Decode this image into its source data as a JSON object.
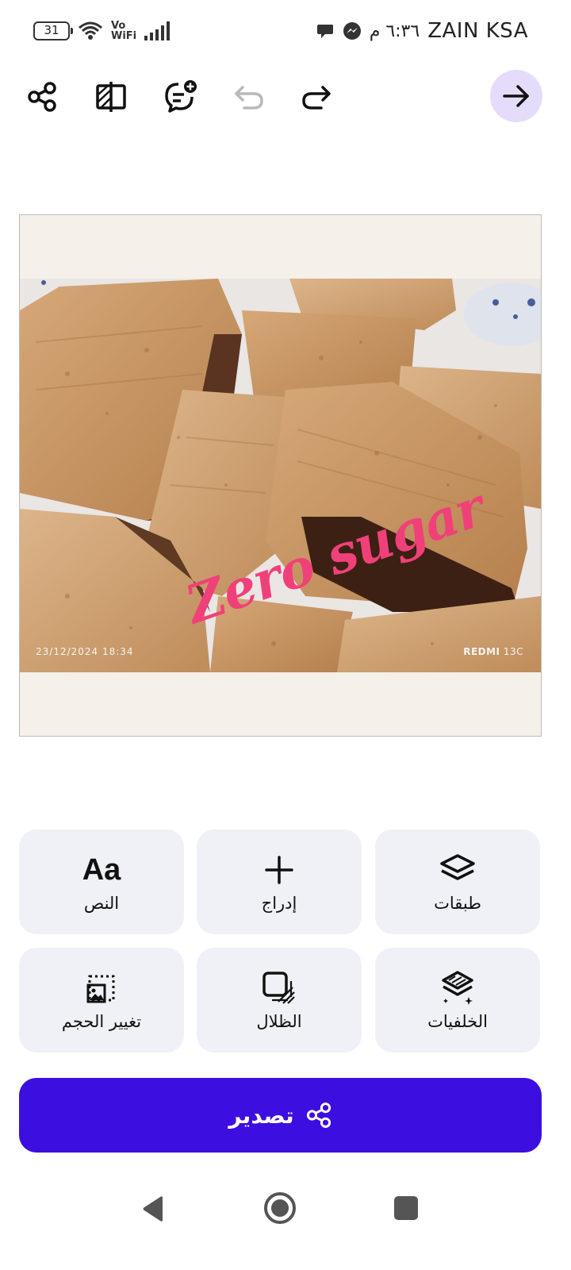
{
  "status_bar": {
    "battery": "31",
    "vowifi_line1": "Vo",
    "vowifi_line2": "WiFi",
    "time": "٦:٣٦ م",
    "carrier": "ZAIN KSA"
  },
  "toolbar": {
    "icons": [
      "share-icon",
      "compare-icon",
      "add-comment-icon",
      "undo-icon",
      "redo-icon"
    ],
    "next_icon": "arrow-right-icon",
    "undo_enabled": false
  },
  "canvas": {
    "overlay_text": "Zero sugar",
    "overlay_color": "#f0407a",
    "timestamp": "23/12/2024  18:34",
    "camera_brand": "REDMI",
    "camera_model": " 13C"
  },
  "tools": [
    {
      "label": "طبقات",
      "icon": "layers-icon"
    },
    {
      "label": "إدراج",
      "icon": "plus-icon"
    },
    {
      "label": "النص",
      "icon": "text-icon",
      "glyph": "Aa"
    },
    {
      "label": "الخلفيات",
      "icon": "backgrounds-icon"
    },
    {
      "label": "الظلال",
      "icon": "shadows-icon"
    },
    {
      "label": "تغيير الحجم",
      "icon": "resize-icon"
    }
  ],
  "export": {
    "label": "تصدير",
    "icon": "share-icon"
  },
  "colors": {
    "accent": "#3d0ee0",
    "next_bg": "#e5dcfb",
    "tool_bg": "#f0f1f6"
  }
}
